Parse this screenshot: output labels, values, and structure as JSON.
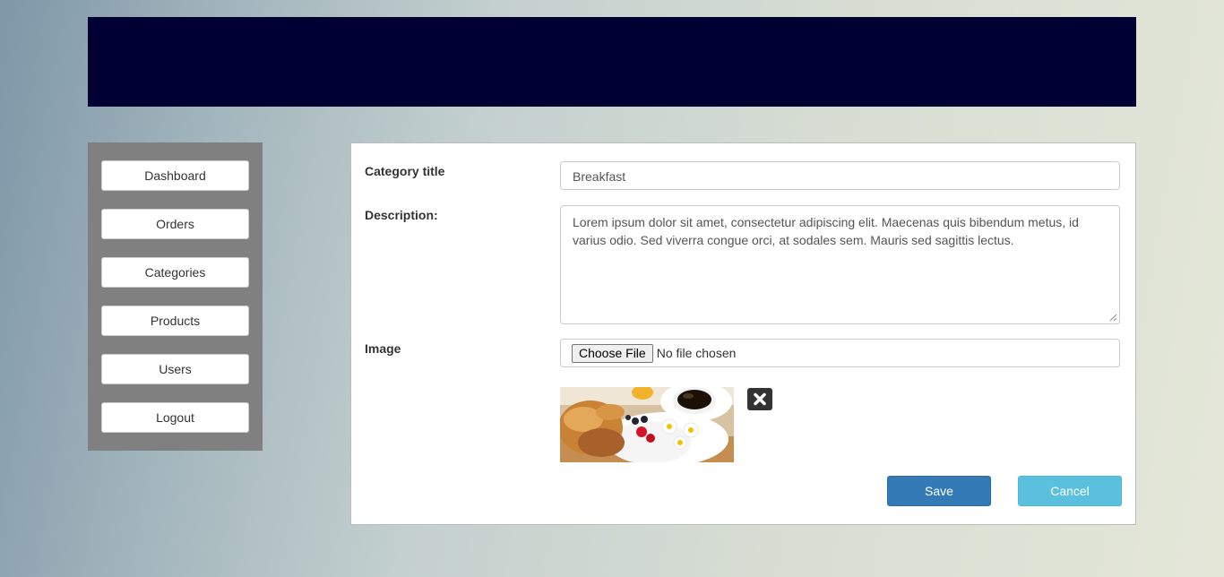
{
  "sidebar": {
    "items": [
      {
        "label": "Dashboard"
      },
      {
        "label": "Orders"
      },
      {
        "label": "Categories"
      },
      {
        "label": "Products"
      },
      {
        "label": "Users"
      },
      {
        "label": "Logout"
      }
    ]
  },
  "form": {
    "title_label": "Category title",
    "title_value": "Breakfast",
    "description_label": "Description:",
    "description_value": "Lorem ipsum dolor sit amet, consectetur adipiscing elit. Maecenas quis bibendum metus, id varius odio. Sed viverra congue orci, at sodales sem. Mauris sed sagittis lectus.",
    "image_label": "Image",
    "file_button_label": "Choose File",
    "file_status": "No file chosen",
    "remove_icon": "close-icon"
  },
  "actions": {
    "save_label": "Save",
    "cancel_label": "Cancel"
  },
  "colors": {
    "header": "#000033",
    "sidebar": "#808080",
    "save": "#337ab7",
    "cancel": "#5bc0de"
  }
}
